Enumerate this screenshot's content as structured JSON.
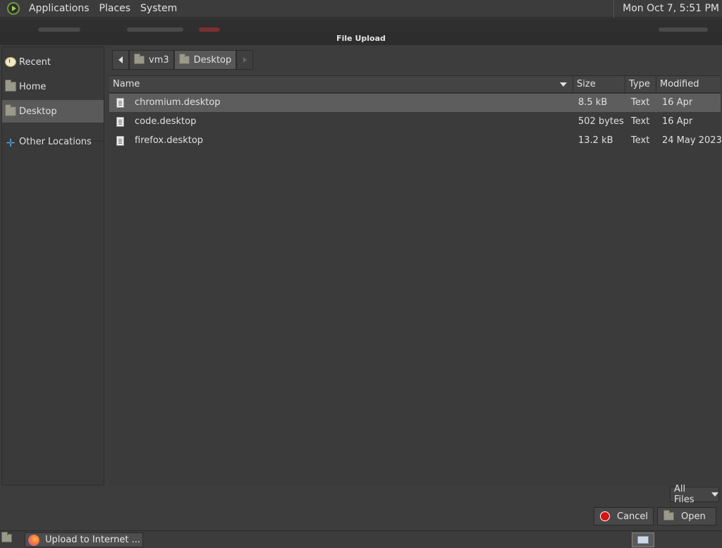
{
  "top_panel": {
    "menus": [
      "Applications",
      "Places",
      "System"
    ],
    "clock": "Mon Oct  7,  5:51 PM"
  },
  "dialog": {
    "title": "File Upload"
  },
  "sidebar": {
    "items": [
      {
        "label": "Recent",
        "icon": "recent-clock-icon"
      },
      {
        "label": "Home",
        "icon": "home-folder-icon"
      },
      {
        "label": "Desktop",
        "icon": "desktop-folder-icon",
        "active": true
      },
      {
        "label": "Other Locations",
        "icon": "plus-icon"
      }
    ]
  },
  "pathbar": {
    "segments": [
      "vm3",
      "Desktop"
    ],
    "active": "Desktop"
  },
  "file_list": {
    "columns": [
      "Name",
      "Size",
      "Type",
      "Modified"
    ],
    "sort_column": "Name",
    "rows": [
      {
        "name": "chromium.desktop",
        "size": "8.5 kB",
        "type": "Text",
        "modified": "16 Apr",
        "selected": true
      },
      {
        "name": "code.desktop",
        "size": "502 bytes",
        "type": "Text",
        "modified": "16 Apr"
      },
      {
        "name": "firefox.desktop",
        "size": "13.2 kB",
        "type": "Text",
        "modified": "24 May 2023"
      }
    ]
  },
  "filter": {
    "label": "All Files"
  },
  "buttons": {
    "cancel": "Cancel",
    "open": "Open"
  },
  "taskbar": {
    "task_label": "Upload to Internet ..."
  },
  "colors": {
    "selection": "#5d5d5d",
    "cancel_icon": "#dd1111",
    "background": "#3d3d3d"
  }
}
